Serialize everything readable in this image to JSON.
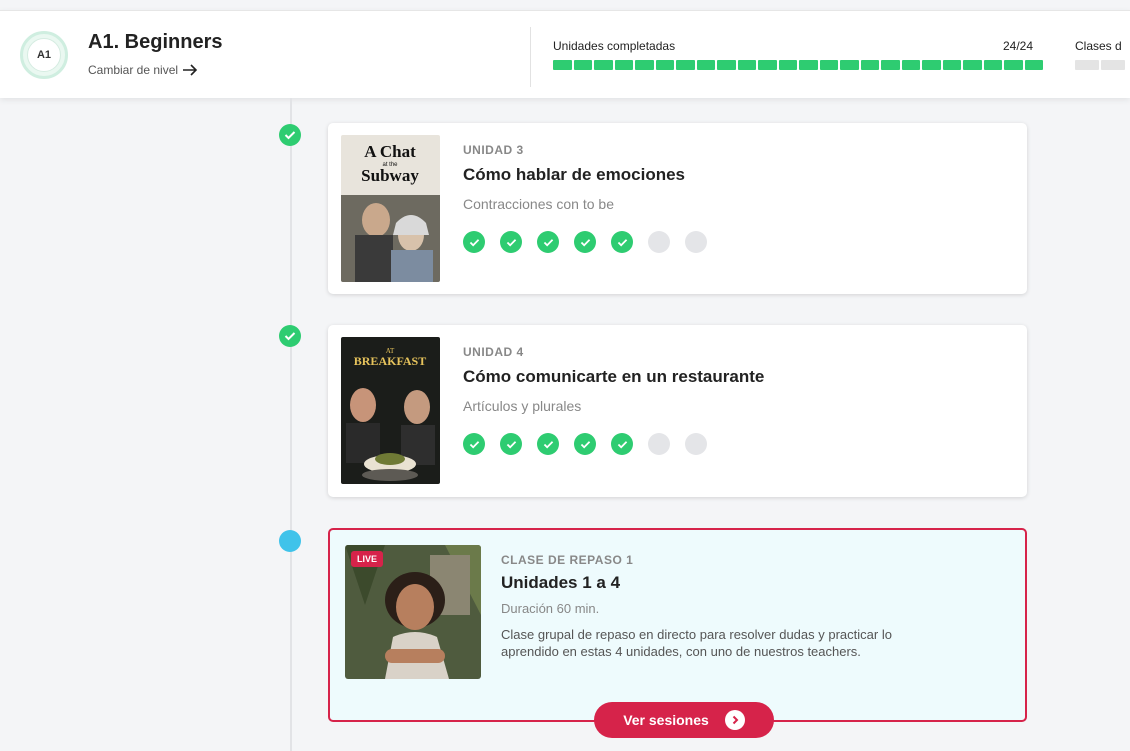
{
  "header": {
    "badge_text": "A1",
    "level_title": "A1. Beginners",
    "change_level": "Cambiar de nivel",
    "progress_label": "Unidades completadas",
    "progress_count": "24/24",
    "progress_completed": 24,
    "progress_total": 24,
    "clases_label": "Clases d"
  },
  "units": [
    {
      "label": "UNIDAD 3",
      "title": "Cómo hablar de emociones",
      "subtitle": "Contracciones con to be",
      "thumb_text_1": "A Chat",
      "thumb_text_2": "at the",
      "thumb_text_3": "Subway",
      "lessons_done": 5,
      "lessons_total": 7
    },
    {
      "label": "UNIDAD 4",
      "title": "Cómo comunicarte en un restaurante",
      "subtitle": "Artículos y plurales",
      "thumb_text_1": "AT",
      "thumb_text_2": "BREAKFAST",
      "lessons_done": 5,
      "lessons_total": 7
    }
  ],
  "live_class": {
    "pill": "LIVE",
    "label": "CLASE DE REPASO 1",
    "title": "Unidades 1 a 4",
    "duration": "Duración 60 min.",
    "description": "Clase grupal de repaso en directo para resolver dudas y practicar lo aprendido en estas 4 unidades, con uno de nuestros teachers.",
    "button": "Ver sesiones"
  },
  "colors": {
    "accent_green": "#2ecc71",
    "live_red": "#d6234a",
    "live_dot": "#3fc3ea"
  }
}
